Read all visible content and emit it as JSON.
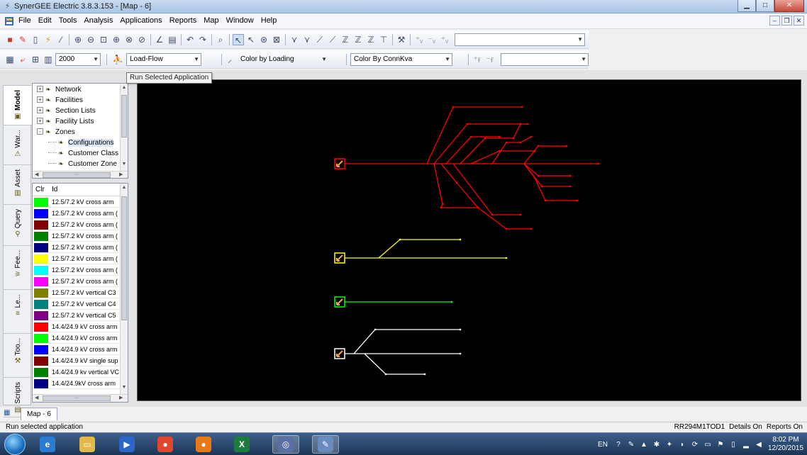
{
  "window": {
    "title": "SynerGEE Electric 3.8.3.153 - [Map - 6]"
  },
  "menu": {
    "items": [
      "File",
      "Edit",
      "Tools",
      "Analysis",
      "Applications",
      "Reports",
      "Map",
      "Window",
      "Help"
    ]
  },
  "toolbar2": {
    "year_value": "2000",
    "app_value": "Load-Flow",
    "color1_value": "Color by Loading",
    "color2_value": "Color By ConnKva"
  },
  "tooltip": {
    "text": "Run Selected Application"
  },
  "vertical_tabs": [
    {
      "label": "Model",
      "icon": "model-icon",
      "active": true
    },
    {
      "label": "War...",
      "icon": "warning-icon",
      "active": false
    },
    {
      "label": "Asset",
      "icon": "asset-icon",
      "active": false
    },
    {
      "label": "Query",
      "icon": "query-icon",
      "active": false
    },
    {
      "label": "Fee...",
      "icon": "feeder-icon",
      "active": false
    },
    {
      "label": "Le...",
      "icon": "legend-icon",
      "active": false
    },
    {
      "label": "Too...",
      "icon": "tools-icon",
      "active": false
    },
    {
      "label": "Scripts",
      "icon": "scripts-icon",
      "active": false
    }
  ],
  "tree": {
    "items": [
      {
        "label": "Network",
        "indent": 0,
        "expander": "+"
      },
      {
        "label": "Facilities",
        "indent": 0,
        "expander": "+"
      },
      {
        "label": "Section Lists",
        "indent": 0,
        "expander": "+"
      },
      {
        "label": "Facility Lists",
        "indent": 0,
        "expander": "+"
      },
      {
        "label": "Zones",
        "indent": 0,
        "expander": "-"
      },
      {
        "label": "Configurations",
        "indent": 1,
        "expander": ""
      },
      {
        "label": "Customer Class",
        "indent": 1,
        "expander": ""
      },
      {
        "label": "Customer Zone",
        "indent": 1,
        "expander": ""
      }
    ]
  },
  "color_list": {
    "header_clr": "Clr",
    "header_id": "Id",
    "rows": [
      {
        "color": "#00ff00",
        "label": "12.5/7.2 kV  cross arm"
      },
      {
        "color": "#0000ff",
        "label": "12.5/7.2 kV cross arm ("
      },
      {
        "color": "#800000",
        "label": "12.5/7.2 kV cross arm ("
      },
      {
        "color": "#008000",
        "label": "12.5/7.2 kV cross arm ("
      },
      {
        "color": "#000080",
        "label": "12.5/7.2 kV cross arm ("
      },
      {
        "color": "#ffff00",
        "label": "12.5/7.2 kV cross arm ("
      },
      {
        "color": "#00ffff",
        "label": "12.5/7.2 kV cross arm ("
      },
      {
        "color": "#ff00ff",
        "label": "12.5/7.2 kV cross arm ("
      },
      {
        "color": "#808000",
        "label": "12.5/7.2 kV vertical C3"
      },
      {
        "color": "#008080",
        "label": "12.5/7.2 kV vertical C4"
      },
      {
        "color": "#800080",
        "label": "12.5/7.2 kV vertical C5"
      },
      {
        "color": "#ff0000",
        "label": "14.4/24.9 kV cross arm"
      },
      {
        "color": "#00ff00",
        "label": "14.4/24.9 kV cross arm"
      },
      {
        "color": "#0000ff",
        "label": "14.4/24.9 kV cross arm"
      },
      {
        "color": "#800000",
        "label": "14.4/24.9 kV single sup"
      },
      {
        "color": "#008000",
        "label": "14.4/24.9 kv vertical VC"
      },
      {
        "color": "#000080",
        "label": "14.4/24.9kV cross arm"
      }
    ]
  },
  "document_tab": {
    "label": "Map - 6"
  },
  "status": {
    "left": "Run selected application",
    "right": [
      "RR294M1TOD1",
      "Details On",
      "Reports On"
    ]
  },
  "taskbar": {
    "apps": [
      {
        "icon": "ie-icon",
        "color": "#2a7bd1",
        "glyph": "e"
      },
      {
        "icon": "folder-icon",
        "color": "#e3b84a",
        "glyph": "▭"
      },
      {
        "icon": "media-player-icon",
        "color": "#2b66c9",
        "glyph": "▶"
      },
      {
        "icon": "chrome-icon",
        "color": "#e1462f",
        "glyph": "●"
      },
      {
        "icon": "firefox-icon",
        "color": "#e67a17",
        "glyph": "●"
      },
      {
        "icon": "excel-icon",
        "color": "#1d7b3d",
        "glyph": "X"
      },
      {
        "icon": "synergee-icon",
        "color": "#5a6fa4",
        "glyph": "◎"
      },
      {
        "icon": "paint-icon",
        "color": "#6a8ac0",
        "glyph": "✎"
      }
    ],
    "tray_language": "EN",
    "clock_time": "8:02 PM",
    "clock_date": "12/20/2015"
  },
  "feeders": [
    {
      "name": "red",
      "color": "#ff0000"
    },
    {
      "name": "yellow",
      "color": "#ffff00"
    },
    {
      "name": "green",
      "color": "#00ff00"
    },
    {
      "name": "white",
      "color": "#ffffff"
    }
  ]
}
